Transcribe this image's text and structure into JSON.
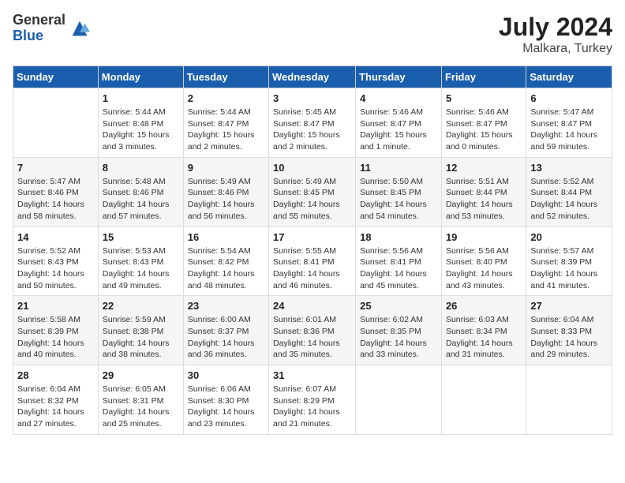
{
  "header": {
    "logo_general": "General",
    "logo_blue": "Blue",
    "month_year": "July 2024",
    "location": "Malkara, Turkey"
  },
  "days_of_week": [
    "Sunday",
    "Monday",
    "Tuesday",
    "Wednesday",
    "Thursday",
    "Friday",
    "Saturday"
  ],
  "weeks": [
    [
      {
        "day": "",
        "info": ""
      },
      {
        "day": "1",
        "info": "Sunrise: 5:44 AM\nSunset: 8:48 PM\nDaylight: 15 hours\nand 3 minutes."
      },
      {
        "day": "2",
        "info": "Sunrise: 5:44 AM\nSunset: 8:47 PM\nDaylight: 15 hours\nand 2 minutes."
      },
      {
        "day": "3",
        "info": "Sunrise: 5:45 AM\nSunset: 8:47 PM\nDaylight: 15 hours\nand 2 minutes."
      },
      {
        "day": "4",
        "info": "Sunrise: 5:46 AM\nSunset: 8:47 PM\nDaylight: 15 hours\nand 1 minute."
      },
      {
        "day": "5",
        "info": "Sunrise: 5:46 AM\nSunset: 8:47 PM\nDaylight: 15 hours\nand 0 minutes."
      },
      {
        "day": "6",
        "info": "Sunrise: 5:47 AM\nSunset: 8:47 PM\nDaylight: 14 hours\nand 59 minutes."
      }
    ],
    [
      {
        "day": "7",
        "info": "Sunrise: 5:47 AM\nSunset: 8:46 PM\nDaylight: 14 hours\nand 58 minutes."
      },
      {
        "day": "8",
        "info": "Sunrise: 5:48 AM\nSunset: 8:46 PM\nDaylight: 14 hours\nand 57 minutes."
      },
      {
        "day": "9",
        "info": "Sunrise: 5:49 AM\nSunset: 8:46 PM\nDaylight: 14 hours\nand 56 minutes."
      },
      {
        "day": "10",
        "info": "Sunrise: 5:49 AM\nSunset: 8:45 PM\nDaylight: 14 hours\nand 55 minutes."
      },
      {
        "day": "11",
        "info": "Sunrise: 5:50 AM\nSunset: 8:45 PM\nDaylight: 14 hours\nand 54 minutes."
      },
      {
        "day": "12",
        "info": "Sunrise: 5:51 AM\nSunset: 8:44 PM\nDaylight: 14 hours\nand 53 minutes."
      },
      {
        "day": "13",
        "info": "Sunrise: 5:52 AM\nSunset: 8:44 PM\nDaylight: 14 hours\nand 52 minutes."
      }
    ],
    [
      {
        "day": "14",
        "info": "Sunrise: 5:52 AM\nSunset: 8:43 PM\nDaylight: 14 hours\nand 50 minutes."
      },
      {
        "day": "15",
        "info": "Sunrise: 5:53 AM\nSunset: 8:43 PM\nDaylight: 14 hours\nand 49 minutes."
      },
      {
        "day": "16",
        "info": "Sunrise: 5:54 AM\nSunset: 8:42 PM\nDaylight: 14 hours\nand 48 minutes."
      },
      {
        "day": "17",
        "info": "Sunrise: 5:55 AM\nSunset: 8:41 PM\nDaylight: 14 hours\nand 46 minutes."
      },
      {
        "day": "18",
        "info": "Sunrise: 5:56 AM\nSunset: 8:41 PM\nDaylight: 14 hours\nand 45 minutes."
      },
      {
        "day": "19",
        "info": "Sunrise: 5:56 AM\nSunset: 8:40 PM\nDaylight: 14 hours\nand 43 minutes."
      },
      {
        "day": "20",
        "info": "Sunrise: 5:57 AM\nSunset: 8:39 PM\nDaylight: 14 hours\nand 41 minutes."
      }
    ],
    [
      {
        "day": "21",
        "info": "Sunrise: 5:58 AM\nSunset: 8:39 PM\nDaylight: 14 hours\nand 40 minutes."
      },
      {
        "day": "22",
        "info": "Sunrise: 5:59 AM\nSunset: 8:38 PM\nDaylight: 14 hours\nand 38 minutes."
      },
      {
        "day": "23",
        "info": "Sunrise: 6:00 AM\nSunset: 8:37 PM\nDaylight: 14 hours\nand 36 minutes."
      },
      {
        "day": "24",
        "info": "Sunrise: 6:01 AM\nSunset: 8:36 PM\nDaylight: 14 hours\nand 35 minutes."
      },
      {
        "day": "25",
        "info": "Sunrise: 6:02 AM\nSunset: 8:35 PM\nDaylight: 14 hours\nand 33 minutes."
      },
      {
        "day": "26",
        "info": "Sunrise: 6:03 AM\nSunset: 8:34 PM\nDaylight: 14 hours\nand 31 minutes."
      },
      {
        "day": "27",
        "info": "Sunrise: 6:04 AM\nSunset: 8:33 PM\nDaylight: 14 hours\nand 29 minutes."
      }
    ],
    [
      {
        "day": "28",
        "info": "Sunrise: 6:04 AM\nSunset: 8:32 PM\nDaylight: 14 hours\nand 27 minutes."
      },
      {
        "day": "29",
        "info": "Sunrise: 6:05 AM\nSunset: 8:31 PM\nDaylight: 14 hours\nand 25 minutes."
      },
      {
        "day": "30",
        "info": "Sunrise: 6:06 AM\nSunset: 8:30 PM\nDaylight: 14 hours\nand 23 minutes."
      },
      {
        "day": "31",
        "info": "Sunrise: 6:07 AM\nSunset: 8:29 PM\nDaylight: 14 hours\nand 21 minutes."
      },
      {
        "day": "",
        "info": ""
      },
      {
        "day": "",
        "info": ""
      },
      {
        "day": "",
        "info": ""
      }
    ]
  ]
}
